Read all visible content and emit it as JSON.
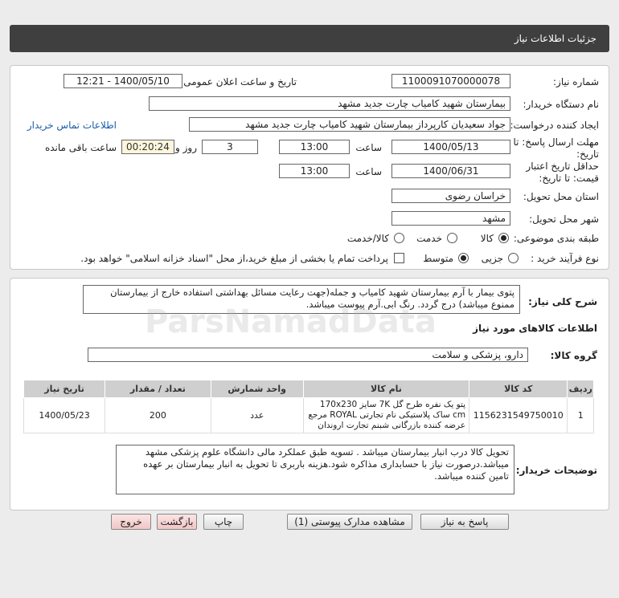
{
  "title": "جزئیات اطلاعات نیاز",
  "fields": {
    "need_number_label": "شماره نیاز:",
    "need_number": "1100091070000078",
    "announce_label": "تاریخ و ساعت اعلان عمومی:",
    "announce_value": "1400/05/10 - 12:21",
    "buyer_org_label": "نام دستگاه خریدار:",
    "buyer_org": "بیمارستان شهید کامیاب چارت جدید مشهد",
    "creator_label": "ایجاد کننده درخواست:",
    "creator": "جواد سعیدیان کارپرداز بیمارستان شهید کامیاب چارت جدید مشهد",
    "contact_link": "اطلاعات تماس خریدار",
    "deadline_label_1": "مهلت ارسال پاسخ: تا",
    "deadline_label_2": "تاریخ:",
    "deadline_date": "1400/05/13",
    "time_label": "ساعت",
    "deadline_time": "13:00",
    "days_value": "3",
    "days_label": "روز و",
    "remaining_time": "00:20:24",
    "remaining_label": "ساعت باقی مانده",
    "validity_label_1": "حداقل تاریخ اعتبار",
    "validity_label_2": "قیمت: تا تاریخ:",
    "validity_date": "1400/06/31",
    "validity_time": "13:00",
    "province_label": "استان محل تحویل:",
    "province": "خراسان رضوی",
    "city_label": "شهر محل تحویل:",
    "city": "مشهد",
    "category_label": "طبقه بندی موضوعی:",
    "category_options": [
      "کالا",
      "خدمت",
      "کالا/خدمت"
    ],
    "process_label": "نوع فرآیند خرید :",
    "process_options": [
      "جزیی",
      "متوسط"
    ],
    "payment_note": "پرداخت تمام یا بخشی از مبلغ خرید،از محل \"اسناد خزانه اسلامی\" خواهد بود."
  },
  "summary": {
    "label": "شرح کلی نیاز:",
    "text": "پتوی بیمار با آرم بیمارستان شهید کامیاب و جمله(جهت رعایت مسائل بهداشتی استفاده خارج از بیمارستان ممنوع میباشد) درج گردد. رنگ ابی.آرم پیوست میباشد."
  },
  "goods_info_title": "اطلاعات کالاهای مورد نیاز",
  "goods_group_label": "گروه کالا:",
  "goods_group": "دارو، پزشکی و سلامت",
  "table": {
    "headers": [
      "ردیف",
      "کد کالا",
      "نام کالا",
      "واحد شمارش",
      "تعداد / مقدار",
      "تاریخ نیاز"
    ],
    "rows": [
      {
        "row": "1",
        "code": "1156231549750010",
        "name": "پتو یک نفره طرح گل 7K سایز 170x230 cm ساک پلاستیکی نام تجارتی ROYAL مرجع عرضه کننده بازرگانی شبنم تجارت اروندان",
        "unit": "عدد",
        "qty": "200",
        "date": "1400/05/23"
      }
    ]
  },
  "buyer_notes_label": "توضیحات خریدار:",
  "buyer_notes": "تحویل کالا درب انبار بیمارستان میباشد . تسویه طبق عملکرد مالی دانشگاه علوم پزشکی مشهد میباشد.درصورت نیاز با حسابداری مذاکره شود.هزینه باربری تا تحویل به انبار بیمارستان بر عهده تامین کننده میباشد.",
  "buttons": {
    "reply": "پاسخ به نیاز",
    "attachments": "مشاهده مدارک پیوستی (1)",
    "print": "چاپ",
    "back": "بازگشت",
    "exit": "خروج"
  },
  "watermark": "ParsNamadData",
  "colors": {
    "titlebar": "#3f3f3f",
    "link": "#1a5ea8",
    "table_header": "#cfcfcf",
    "pink_button": "#f1c6c6"
  }
}
